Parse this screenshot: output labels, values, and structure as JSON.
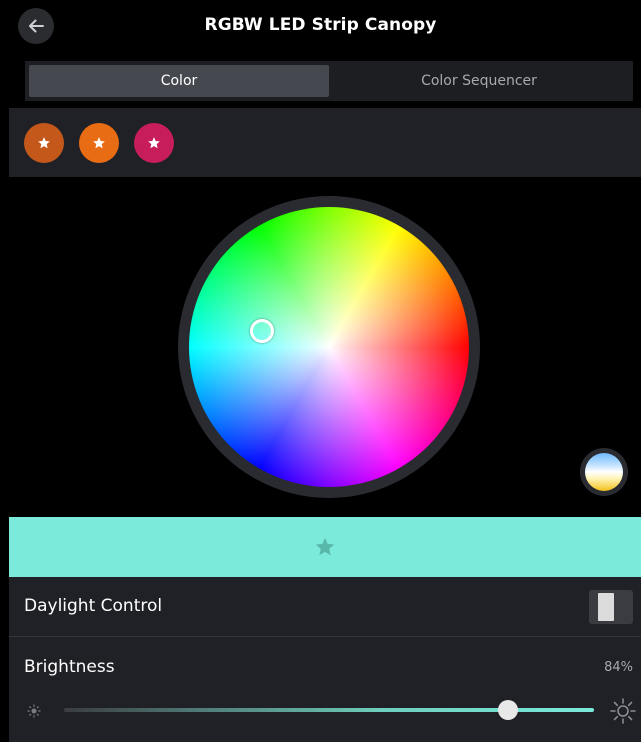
{
  "header": {
    "title": "RGBW LED Strip Canopy"
  },
  "tabs": [
    {
      "label": "Color",
      "active": true
    },
    {
      "label": "Color Sequencer",
      "active": false
    }
  ],
  "presets": [
    {
      "color": "#c4581b",
      "icon": "star-icon"
    },
    {
      "color": "#e86c13",
      "icon": "star-icon"
    },
    {
      "color": "#c71d5a",
      "icon": "star-icon"
    }
  ],
  "selected_color": "#7beadb",
  "daylight_control": {
    "label": "Daylight Control",
    "enabled": false
  },
  "brightness": {
    "label": "Brightness",
    "value_text": "84%",
    "value": 84
  }
}
